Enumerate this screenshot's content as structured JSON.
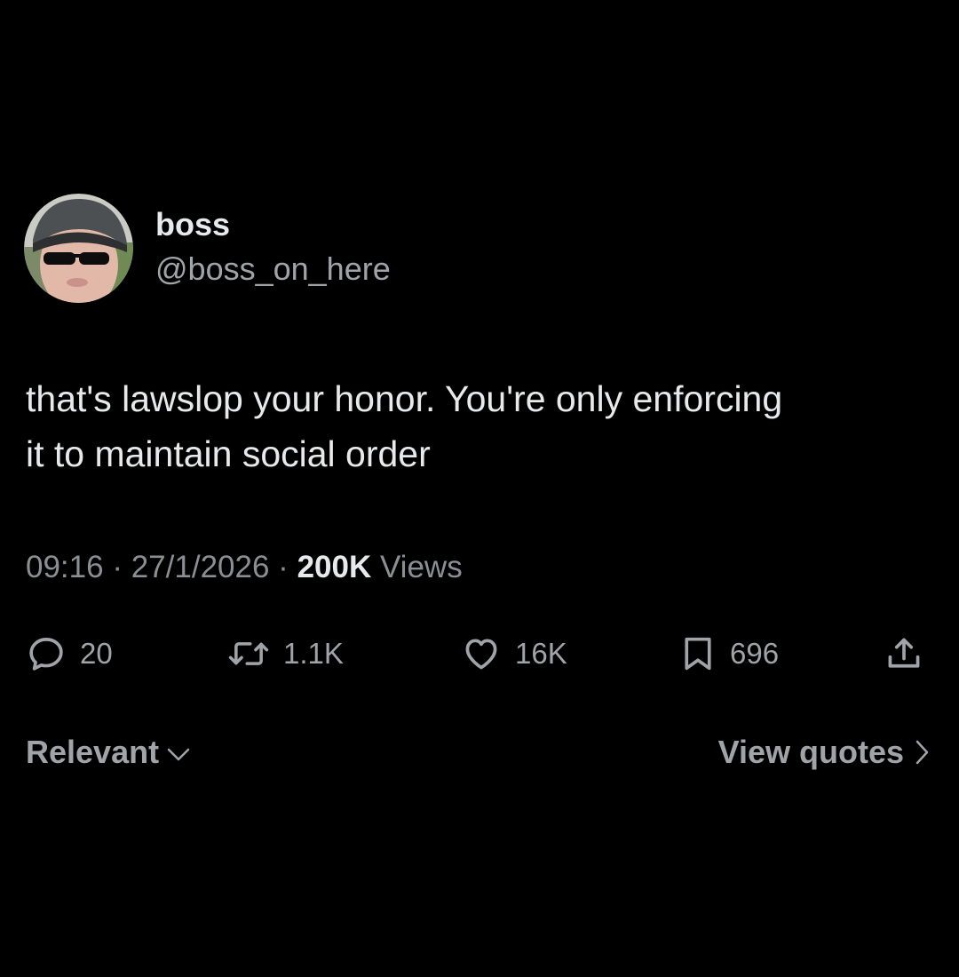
{
  "author": {
    "display_name": "boss",
    "handle": "@boss_on_here",
    "avatar_icon": "avatar-photo-icon"
  },
  "tweet": {
    "text": "that's lawslop your honor. You're only enforcing\nit to maintain social order"
  },
  "meta": {
    "time": "09:16",
    "separator": "·",
    "date": "27/1/2026",
    "views_count": "200K",
    "views_label": "Views"
  },
  "actions": {
    "replies": "20",
    "reposts": "1.1K",
    "likes": "16K",
    "bookmarks": "696"
  },
  "footer": {
    "sort_label": "Relevant",
    "view_quotes_label": "View quotes"
  },
  "colors": {
    "background": "#000000",
    "primary_text": "#e7e9ea",
    "secondary_text": "#a0a4a8"
  }
}
